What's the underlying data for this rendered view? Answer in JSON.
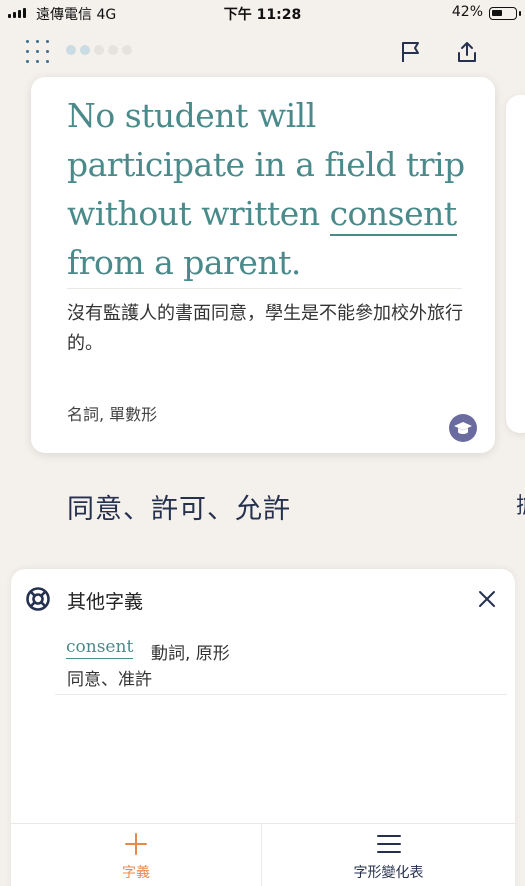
{
  "status_bar": {
    "carrier": "遠傳電信 4G",
    "time": "下午 11:28",
    "battery": "42%"
  },
  "header": {
    "menu_icon": "grid-dots-icon",
    "flag_icon": "flag-icon",
    "share_icon": "share-icon",
    "progress_total": 5,
    "progress_done": 2
  },
  "card": {
    "sentence_before": "No student will participate in a field trip without written",
    "keyword": "consent",
    "sentence_after": "from a parent.",
    "translation": "沒有監護人的書面同意，學生是不能參加校外旅行的。",
    "part_of_speech": "名詞, 單數形",
    "level_icon": "graduation-cap-icon"
  },
  "meaning": "同意、許可、允許",
  "next_card_peek": "擔",
  "other_senses": {
    "title": "其他字義",
    "items": [
      {
        "word": "consent",
        "pos": "動詞, 原形",
        "definition": "同意、准許"
      }
    ]
  },
  "tabs": [
    {
      "label": "字義",
      "icon": "plus-icon",
      "active": true
    },
    {
      "label": "字形變化表",
      "icon": "menu-lines-icon",
      "active": false
    }
  ],
  "colors": {
    "accent": "#4b8a8a",
    "navy": "#26314f",
    "tab_active": "#e8894a",
    "background": "#f4f0ec"
  }
}
